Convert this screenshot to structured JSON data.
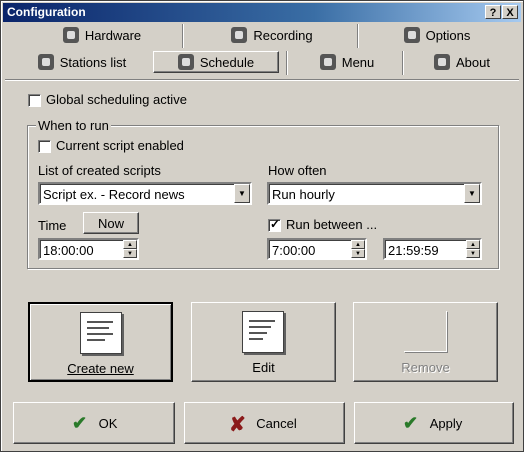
{
  "window": {
    "title": "Configuration",
    "help_btn": "?",
    "close_btn": "X"
  },
  "tabs_row1": [
    {
      "label": "Hardware",
      "icon": "hardware-icon"
    },
    {
      "label": "Recording",
      "icon": "recording-icon"
    },
    {
      "label": "Options",
      "icon": "options-icon"
    }
  ],
  "tabs_row2": [
    {
      "label": "Stations list",
      "icon": "stations-icon"
    },
    {
      "label": "Schedule",
      "icon": "clock-icon",
      "active": true
    },
    {
      "label": "Menu",
      "icon": "menu-icon"
    },
    {
      "label": "About",
      "icon": "about-icon"
    }
  ],
  "global_scheduling": {
    "label": "Global scheduling active",
    "checked": false
  },
  "group": {
    "legend": "When to run",
    "current_script": {
      "label": "Current script enabled",
      "checked": false
    },
    "scripts_label": "List of created scripts",
    "script_value": "Script ex. - Record news",
    "how_often_label": "How often",
    "how_often_value": "Run hourly",
    "time_label": "Time",
    "now_button": "Now",
    "time_value": "18:00:00",
    "run_between": {
      "label": "Run between ...",
      "checked": true
    },
    "between_start": "7:00:00",
    "between_end": "21:59:59"
  },
  "actions": {
    "create": "Create new",
    "edit": "Edit",
    "remove": "Remove"
  },
  "footer": {
    "ok": "OK",
    "cancel": "Cancel",
    "apply": "Apply"
  }
}
